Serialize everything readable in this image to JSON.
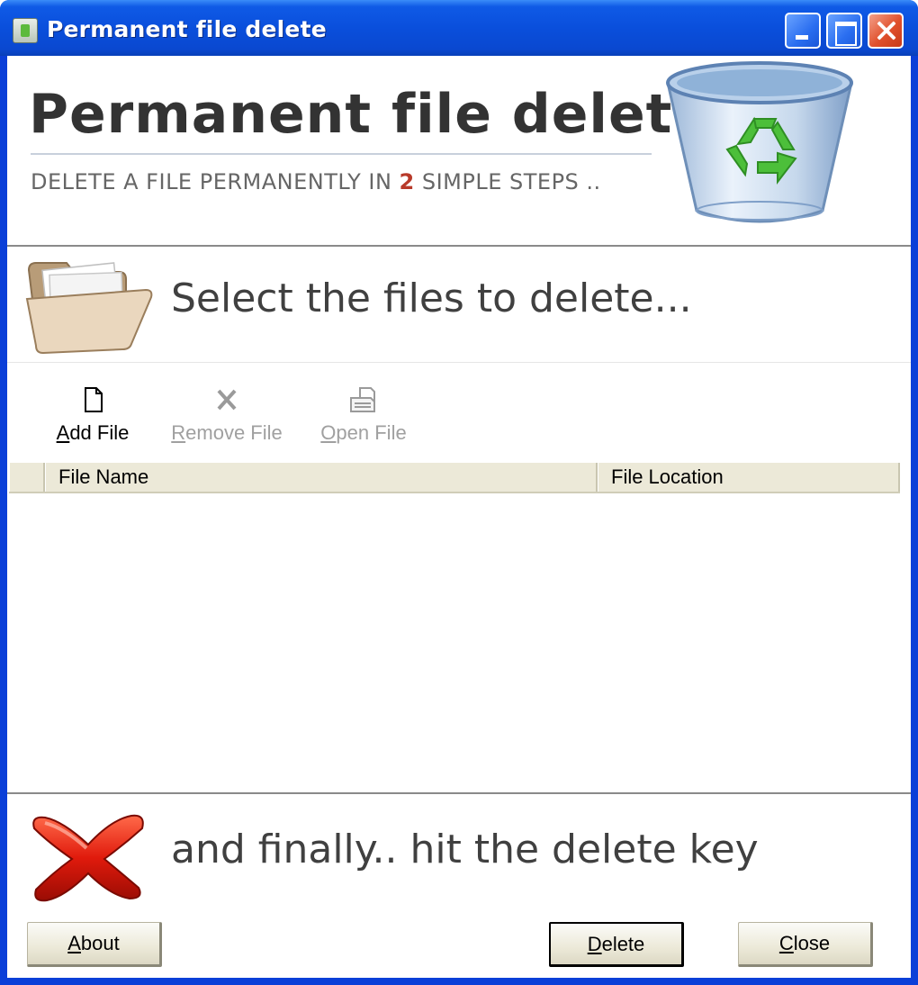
{
  "window": {
    "title": "Permanent file delete",
    "controls": {
      "minimize": "minimize-icon",
      "maximize": "maximize-icon",
      "close": "close-icon"
    }
  },
  "header": {
    "title": "Permanent file delete",
    "subtitle_before": "DELETE A FILE PERMANENTLY IN ",
    "subtitle_number": "2",
    "subtitle_after": " SIMPLE STEPS ..",
    "icon": "recycle-bin-icon"
  },
  "step1": {
    "text": "Select the files to delete...",
    "icon": "folder-icon"
  },
  "toolbar": {
    "add": {
      "mnemonic": "A",
      "rest": "dd File",
      "icon": "new-file-icon",
      "enabled": true
    },
    "remove": {
      "mnemonic": "R",
      "rest": "emove File",
      "icon": "remove-x-icon",
      "enabled": false
    },
    "open": {
      "mnemonic": "O",
      "rest": "pen File",
      "icon": "open-file-icon",
      "enabled": false
    }
  },
  "list": {
    "columns": [
      "File Name",
      "File Location"
    ],
    "rows": []
  },
  "step2": {
    "text": "and finally.. hit the delete key",
    "icon": "red-x-icon"
  },
  "buttons": {
    "about": {
      "mnemonic": "A",
      "rest": "bout"
    },
    "delete": {
      "mnemonic": "D",
      "rest": "elete"
    },
    "close": {
      "mnemonic": "C",
      "rest": "lose"
    }
  },
  "colors": {
    "titlebar": "#0a4fdc",
    "accent_number": "#b83a2a",
    "list_header": "#ece9d8"
  }
}
